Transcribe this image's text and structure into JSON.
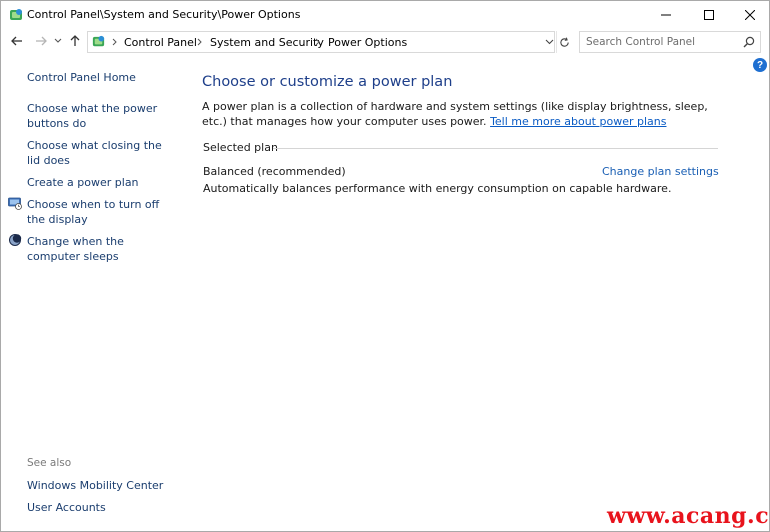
{
  "window": {
    "title": "Control Panel\\System and Security\\Power Options"
  },
  "address": {
    "crumbs": [
      "Control Panel",
      "System and Security",
      "Power Options"
    ]
  },
  "search": {
    "placeholder": "Search Control Panel"
  },
  "help": {
    "label": "?"
  },
  "sidebar": {
    "home": "Control Panel Home",
    "items": [
      {
        "label": "Choose what the power buttons do",
        "icon": "none"
      },
      {
        "label": "Choose what closing the lid does",
        "icon": "none"
      },
      {
        "label": "Create a power plan",
        "icon": "none"
      },
      {
        "label": "Choose when to turn off the display",
        "icon": "display-icon"
      },
      {
        "label": "Change when the computer sleeps",
        "icon": "sleep-moon-icon"
      }
    ],
    "see_also": {
      "heading": "See also",
      "links": [
        "Windows Mobility Center",
        "User Accounts"
      ]
    }
  },
  "main": {
    "title": "Choose or customize a power plan",
    "description": "A power plan is a collection of hardware and system settings (like display brightness, sleep, etc.) that manages how your computer uses power.",
    "learn_more": "Tell me more about power plans",
    "selected_heading": "Selected plan",
    "plan": {
      "name": "Balanced (recommended)",
      "change_link": "Change plan settings",
      "description": "Automatically balances performance with energy consumption on capable hardware."
    }
  },
  "watermark": "www.acang.cn",
  "colors": {
    "link": "#1a3d6e",
    "title_blue": "#1e3f8a",
    "watermark_red": "#e8131c"
  }
}
